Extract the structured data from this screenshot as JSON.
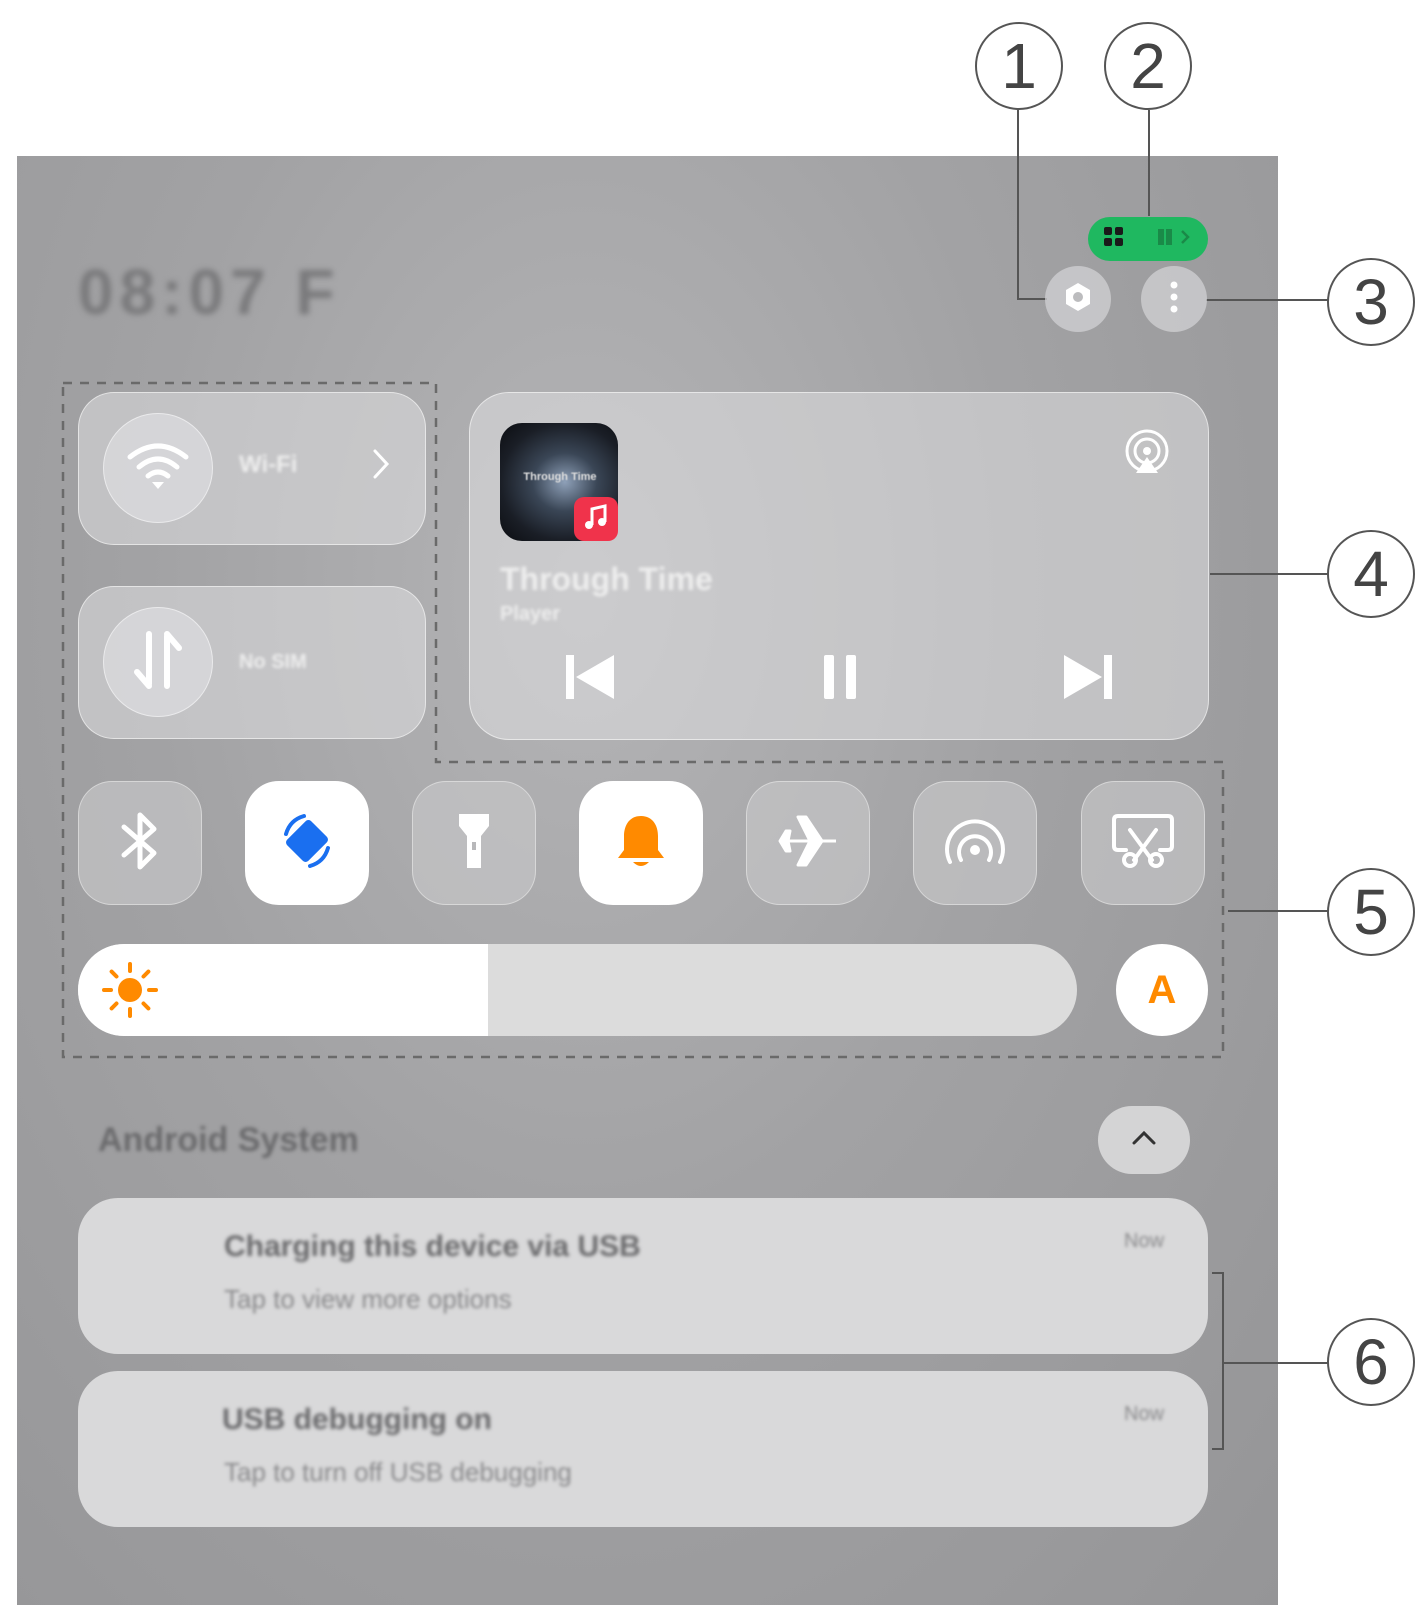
{
  "callouts": [
    "1",
    "2",
    "3",
    "4",
    "5",
    "6"
  ],
  "clock": "08:07 F",
  "status_pill": {
    "color": "#1fb860"
  },
  "connectivity": {
    "wifi_label": "Wi-Fi",
    "mobile_label": "No SIM"
  },
  "media": {
    "album_art_text": "Through Time",
    "title": "Through Time",
    "artist": "Player",
    "app_badge_color": "#f0334b"
  },
  "quick_tiles": [
    {
      "name": "bluetooth",
      "active": false
    },
    {
      "name": "auto-rotate",
      "active": true
    },
    {
      "name": "flashlight",
      "active": false
    },
    {
      "name": "sound",
      "active": true
    },
    {
      "name": "airplane-mode",
      "active": false
    },
    {
      "name": "hotspot",
      "active": false
    },
    {
      "name": "screenshot",
      "active": false
    }
  ],
  "brightness": {
    "level": 0.41,
    "auto_label": "A",
    "accent": "#ff8a00"
  },
  "notifications": {
    "group_title": "Android System",
    "items": [
      {
        "title": "Charging this device via USB",
        "text": "Tap to view more options",
        "time": "Now"
      },
      {
        "title": "USB debugging on",
        "text": "Tap to turn off USB debugging",
        "time": "Now"
      }
    ]
  }
}
